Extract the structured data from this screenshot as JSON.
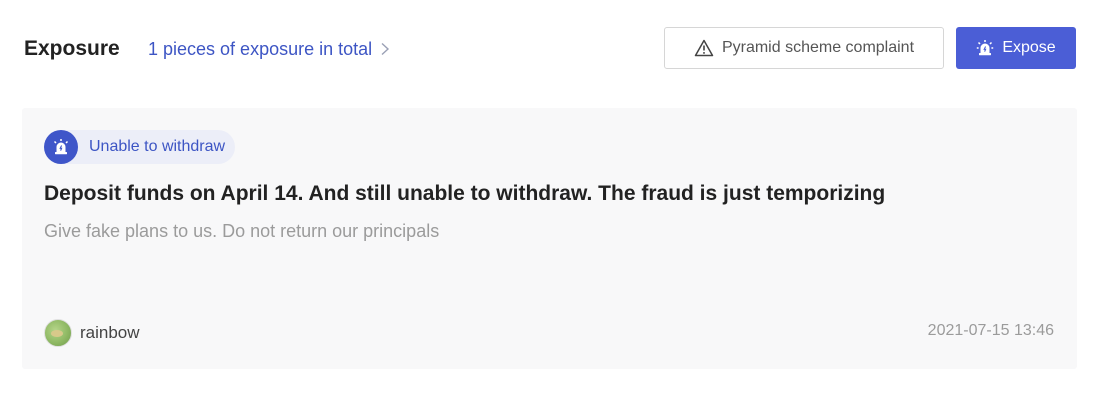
{
  "header": {
    "title": "Exposure",
    "total_link": "1 pieces of exposure in total",
    "complaint_button": "Pyramid scheme complaint",
    "expose_button": "Expose"
  },
  "post": {
    "tag": "Unable to withdraw",
    "title": "Deposit funds on April 14. And still unable to withdraw. The fraud is just temporizing",
    "summary": "Give fake plans to us. Do not return our principals",
    "author": "rainbow",
    "timestamp": "2021-07-15 13:46"
  },
  "icons": {
    "total_link": "chevron-right-icon",
    "complaint": "warning-triangle-icon",
    "expose": "alarm-siren-icon",
    "tag": "alarm-siren-icon",
    "author": "avatar"
  },
  "colors": {
    "accent": "#4b5ed6",
    "link": "#3d55c4",
    "card_background": "#f8f8f9",
    "tag_background": "#eceef8",
    "muted_text": "#9b9b9b"
  }
}
